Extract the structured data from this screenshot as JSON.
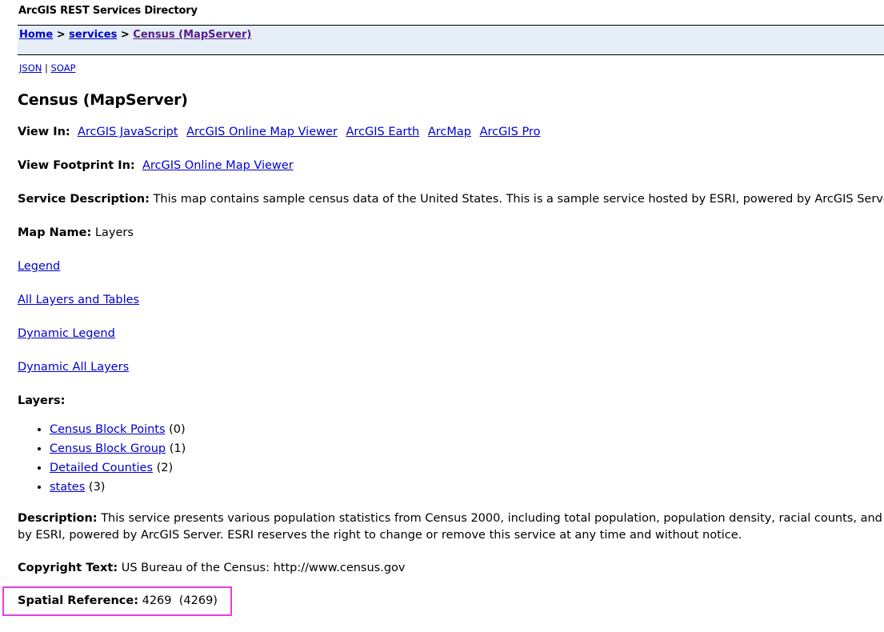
{
  "app_title": "ArcGIS REST Services Directory",
  "breadcrumb": {
    "items": [
      "Home",
      "services",
      "Census (MapServer)"
    ],
    "separator": ">"
  },
  "format_links": {
    "json": "JSON",
    "separator": "|",
    "soap": "SOAP"
  },
  "page_title": "Census (MapServer)",
  "view_in": {
    "label": "View In:",
    "links": [
      "ArcGIS JavaScript",
      "ArcGIS Online Map Viewer",
      "ArcGIS Earth",
      "ArcMap",
      "ArcGIS Pro"
    ]
  },
  "view_footprint": {
    "label": "View Footprint In:",
    "link": "ArcGIS Online Map Viewer"
  },
  "service_description": {
    "label": "Service Description:",
    "text": "This map contains sample census data of the United States. This is a sample service hosted by ESRI, powered by ArcGIS Server. ESRI reserves"
  },
  "map_name": {
    "label": "Map Name:",
    "value": "Layers"
  },
  "links": {
    "legend": "Legend",
    "all_layers": "All Layers and Tables",
    "dynamic_legend": "Dynamic Legend",
    "dynamic_all_layers": "Dynamic All Layers"
  },
  "layers": {
    "label": "Layers:",
    "items": [
      {
        "name": "Census Block Points",
        "id": "(0)"
      },
      {
        "name": "Census Block Group",
        "id": "(1)"
      },
      {
        "name": "Detailed Counties",
        "id": "(2)"
      },
      {
        "name": "states",
        "id": "(3)"
      }
    ]
  },
  "description": {
    "label": "Description:",
    "line1": "This service presents various population statistics from Census 2000, including total population, population density, racial counts, and more. The map",
    "line2": "by ESRI, powered by ArcGIS Server. ESRI reserves the right to change or remove this service at any time and without notice."
  },
  "copyright": {
    "label": "Copyright Text:",
    "value": "US Bureau of the Census: http://www.census.gov"
  },
  "spatial_reference": {
    "label": "Spatial Reference:",
    "wkid": "4269",
    "latest_wkid": "(4269)"
  },
  "colors": {
    "breadcrumb_bg": "#e6eff7",
    "link": "#0000cc",
    "visited_link": "#551a8b",
    "highlight": "#e040e0"
  }
}
